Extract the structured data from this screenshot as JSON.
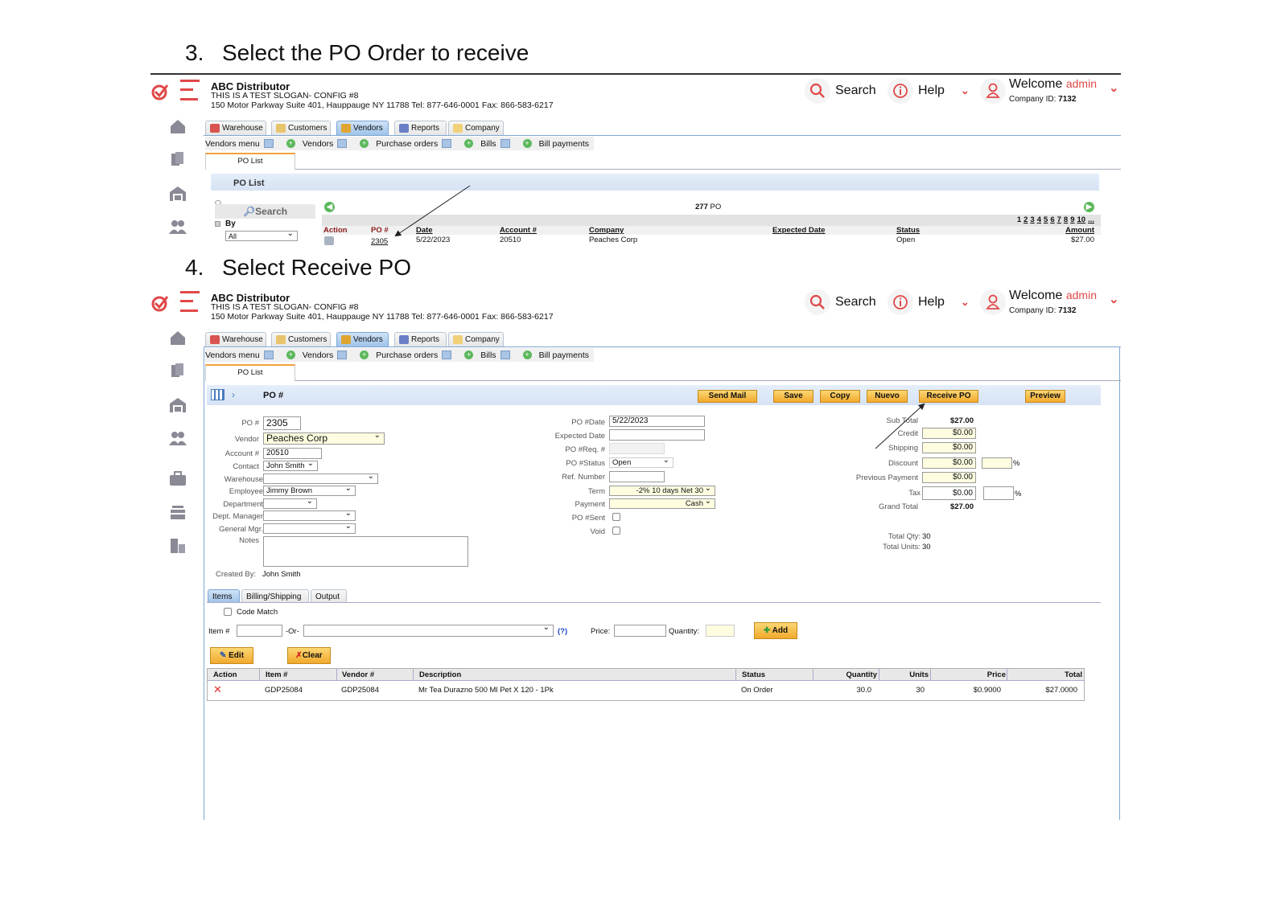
{
  "steps": [
    {
      "number": "3.",
      "title": "Select the PO Order to receive"
    },
    {
      "number": "4.",
      "title": "Select Receive PO"
    }
  ],
  "header": {
    "company_name": "ABC Distributor",
    "slogan": "THIS IS A TEST SLOGAN- CONFIG #8",
    "address": "150 Motor Parkway Suite 401, Hauppauge NY 11788 Tel: 877-646-0001 Fax: 866-583-6217",
    "search_label": "Search",
    "help_label": "Help",
    "welcome_label": "Welcome",
    "username": "admin",
    "company_id_label": "Company ID:",
    "company_id": "7132"
  },
  "nav": {
    "tabs": [
      "Warehouse",
      "Customers",
      "Vendors",
      "Reports",
      "Company"
    ],
    "active_tab": "Vendors",
    "submenu": [
      "Vendors menu",
      "Vendors",
      "Purchase orders",
      "Bills",
      "Bill payments"
    ],
    "page_tab": "PO List"
  },
  "po_list": {
    "title": "PO List",
    "search_label": "Search",
    "by_label": "By",
    "by_value": "All",
    "count": "277",
    "count_unit": "PO",
    "pages": [
      "1",
      "2",
      "3",
      "4",
      "5",
      "6",
      "7",
      "8",
      "9",
      "10",
      "..."
    ],
    "columns": [
      "Action",
      "PO #",
      "Date",
      "Account #",
      "Company",
      "Expected Date",
      "Status",
      "Amount"
    ],
    "rows": [
      {
        "po": "2305",
        "date": "5/22/2023",
        "account": "20510",
        "company": "Peaches Corp",
        "expected": "",
        "status": "Open",
        "amount": "$27.00"
      }
    ]
  },
  "po_form": {
    "title": "PO #",
    "buttons": {
      "send_mail": "Send Mail",
      "save": "Save",
      "copy": "Copy",
      "nuevo": "Nuevo",
      "receive_po": "Receive PO",
      "preview": "Preview"
    },
    "left": {
      "po_label": "PO #",
      "po_value": "2305",
      "vendor_label": "Vendor",
      "vendor_value": "Peaches Corp",
      "account_label": "Account #",
      "account_value": "20510",
      "contact_label": "Contact",
      "contact_value": "John Smith",
      "warehouse_label": "Warehouse",
      "warehouse_value": "",
      "employee_label": "Employee",
      "employee_value": "Jimmy Brown",
      "department_label": "Department",
      "department_value": "",
      "dept_manager_label": "Dept. Manager",
      "dept_manager_value": "",
      "general_mgr_label": "General Mgr.",
      "general_mgr_value": "",
      "notes_label": "Notes",
      "notes_value": "",
      "created_by_label": "Created By:",
      "created_by_value": "John Smith"
    },
    "middle": {
      "date_label": "PO #Date",
      "date_value": "5/22/2023",
      "expected_label": "Expected Date",
      "expected_value": "",
      "req_label": "PO #Req. #",
      "req_value": "",
      "status_label": "PO #Status",
      "status_value": "Open",
      "ref_label": "Ref. Number",
      "ref_value": "",
      "term_label": "Term",
      "term_value": "-2% 10 days Net 30",
      "payment_label": "Payment",
      "payment_value": "Cash",
      "sent_label": "PO #Sent",
      "sent_checked": false,
      "void_label": "Void",
      "void_checked": false
    },
    "totals": {
      "subtotal_label": "Sub Total",
      "subtotal": "$27.00",
      "credit_label": "Credit",
      "credit": "$0.00",
      "shipping_label": "Shipping",
      "shipping": "$0.00",
      "discount_label": "Discount",
      "discount": "$0.00",
      "discount_pct": "",
      "prev_payment_label": "Previous Payment",
      "prev_payment": "$0.00",
      "tax_label": "Tax",
      "tax": "$0.00",
      "tax_pct": "",
      "pct_symbol": "%",
      "grand_total_label": "Grand Total",
      "grand_total": "$27.00",
      "total_qty_label": "Total Qty:",
      "total_qty": "30",
      "total_units_label": "Total Units:",
      "total_units": "30"
    },
    "tabs": [
      "Items",
      "Billing/Shipping",
      "Output"
    ],
    "active_tab": "Items",
    "code_match_label": "Code Match",
    "item_label": "Item #",
    "or_label": "-Or-",
    "help_link": "(?)",
    "price_label": "Price:",
    "quantity_label": "Quantity:",
    "add_label": "Add",
    "edit_label": "Edit",
    "clear_label": "Clear",
    "columns": [
      "Action",
      "Item #",
      "Vendor #",
      "Description",
      "Status",
      "Quantity",
      "Units",
      "Price",
      "Total"
    ],
    "rows": [
      {
        "item": "GDP25084",
        "vendor": "GDP25084",
        "description": "Mr Tea Durazno 500 Ml Pet X 120 - 1Pk",
        "status": "On Order",
        "quantity": "30.0",
        "units": "30",
        "price": "$0.9000",
        "total": "$27.0000"
      }
    ]
  },
  "colors": {
    "brand_red": "#e04848",
    "button_orange": "#f1a92c",
    "band_blue": "#d6e3f5"
  }
}
